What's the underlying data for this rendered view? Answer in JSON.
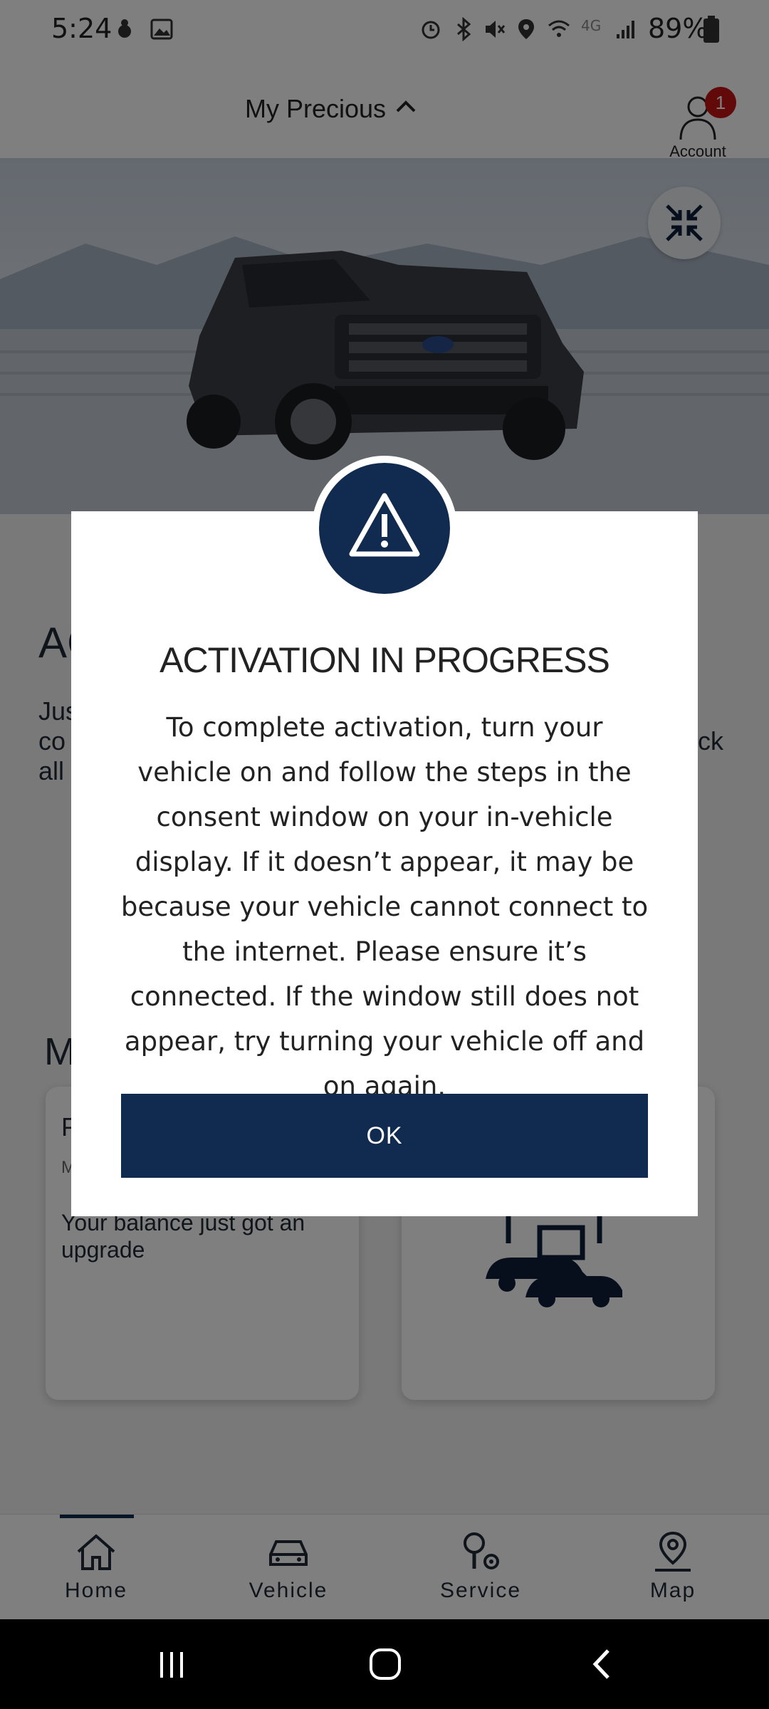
{
  "status_bar": {
    "time": "5:24",
    "battery": "89%",
    "network": "4G"
  },
  "header": {
    "vehicle_name": "My Precious",
    "account_label": "Account",
    "account_badge": "1"
  },
  "page": {
    "section1_title_partial": "AC",
    "section1_body_partial": [
      "Jus",
      "co",
      "all"
    ],
    "section1_body_right_partial": "ck",
    "section2_title_partial": "M",
    "card1": {
      "title_partial": "P",
      "subtitle_partial": "M",
      "text": "Your balance just got an upgrade"
    }
  },
  "bottom_nav": {
    "items": [
      {
        "label": "Home",
        "icon": "home-icon",
        "active": true
      },
      {
        "label": "Vehicle",
        "icon": "car-icon",
        "active": false
      },
      {
        "label": "Service",
        "icon": "service-icon",
        "active": false
      },
      {
        "label": "Map",
        "icon": "map-pin-icon",
        "active": false
      }
    ]
  },
  "modal": {
    "icon": "warning-icon",
    "title": "ACTIVATION IN PROGRESS",
    "body": "To complete activation, turn your vehicle on and follow the steps in the consent window on your in-vehicle display. If it doesn’t appear, it may be because your vehicle cannot connect to the internet. Please ensure it’s connected. If the window still does not appear, try turning your vehicle off and on again.",
    "ok_label": "OK"
  },
  "colors": {
    "brand_navy": "#112a4f",
    "badge_red": "#c41313"
  }
}
